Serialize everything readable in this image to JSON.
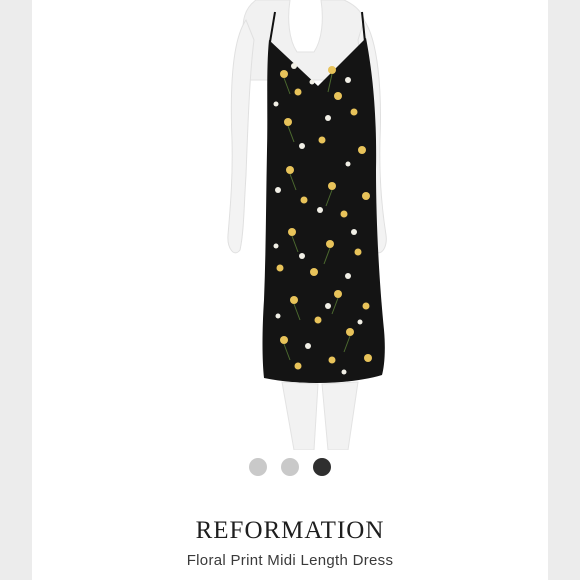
{
  "product": {
    "brand": "REFORMATION",
    "title": "Floral Print Midi Length Dress",
    "image_description_icon": "dress-photo",
    "dress_color": "#141414",
    "flower_colors": [
      "#e8c35a",
      "#f1efe6"
    ]
  },
  "carousel": {
    "count": 3,
    "active_index": 2
  }
}
